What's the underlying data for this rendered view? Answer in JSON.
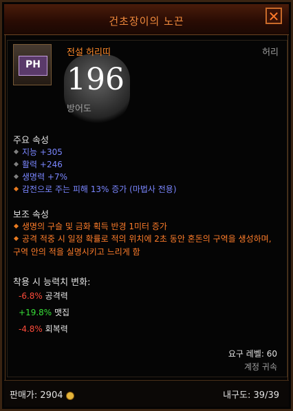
{
  "window": {
    "title": "건초장이의 노끈",
    "close_icon": "close-x-icon"
  },
  "item": {
    "icon": "belt-icon",
    "icon_label": "PH",
    "type": "전설 허리띠",
    "slot": "허리",
    "armor_value": "196",
    "armor_label": "방어도"
  },
  "primary": {
    "title": "주요 속성",
    "props": [
      "지능 +305",
      "활력 +246",
      "생명력 +7%",
      "감전으로 주는 피해 13% 증가 (마법사 전용)"
    ]
  },
  "secondary": {
    "title": "보조 속성",
    "props": [
      "생명의 구슬 및 금화 획득 반경 1미터 증가",
      "공격 적중 시 일정 확률로 적의 위치에 2초 동안 혼돈의 구역을 생성하며, 구역 안의 적을 실명시키고 느리게 함"
    ]
  },
  "stat_changes": {
    "title": "착용 시 능력치 변화:",
    "lines": [
      {
        "value": "-6.8%",
        "label": "공격력"
      },
      {
        "value": "+19.8%",
        "label": "맷집"
      },
      {
        "value": "-4.8%",
        "label": "회복력"
      }
    ]
  },
  "requirements": {
    "level_text": "요구 레벨: 60",
    "bound_text": "계정 귀속"
  },
  "footer": {
    "sell_label": "판매가:",
    "sell_value": "2904",
    "coin_icon": "gold-coin-icon",
    "durability_label": "내구도:",
    "durability_value": "39/39"
  }
}
